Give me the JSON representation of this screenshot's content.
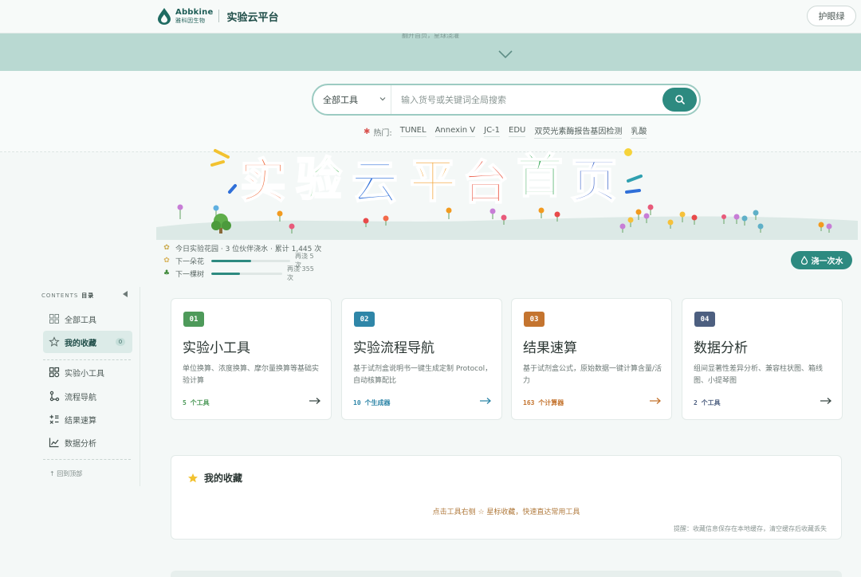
{
  "header": {
    "logo_en": "Abbkine",
    "logo_cn": "雅科因生物",
    "title": "实验云平台",
    "eye_button": "护眼绿"
  },
  "strip": {
    "text": "翻开首页，星球浇灌"
  },
  "search": {
    "scope": "全部工具",
    "placeholder": "输入货号或关键词全局搜索",
    "hot_label": "热门:",
    "hot_tags": [
      "TUNEL",
      "Annexin V",
      "JC-1",
      "EDU",
      "双荧光素酶报告基因检测",
      "乳酸"
    ]
  },
  "banner": {
    "title": "实验云平台首页",
    "colors": [
      "#ef6a3b",
      "#3bb34a",
      "#2f6fd8",
      "#f29a1f",
      "#e8452f",
      "#2fa34f",
      "#3a64c9"
    ]
  },
  "garden": {
    "line1": "今日实验花园 · 3 位伙伴浇水 · 累计 1,445 次",
    "flower_label": "下一朵花",
    "flower_progress": 0.5,
    "flower_remaining": "再浇 5 次",
    "tree_label": "下一棵树",
    "tree_progress": 0.4,
    "tree_remaining": "再浇 355 次",
    "water_button": "浇一次水"
  },
  "sidebar": {
    "contents_en": "CONTENTS",
    "contents_cn": "目录",
    "items": [
      {
        "label": "全部工具"
      },
      {
        "label": "我的收藏",
        "badge": "0"
      },
      {
        "label": "实验小工具"
      },
      {
        "label": "流程导航"
      },
      {
        "label": "结果速算"
      },
      {
        "label": "数据分析"
      }
    ],
    "back_top": "↑ 回到顶部"
  },
  "cards": [
    {
      "num": "01",
      "title": "实验小工具",
      "desc": "单位换算、浓度换算、摩尔量换算等基础实验计算",
      "count": "5 个工具",
      "color": "#4e9a5a"
    },
    {
      "num": "02",
      "title": "实验流程导航",
      "desc": "基于试剂盒说明书一键生成定制 Protocol，自动核算配比",
      "count": "10 个生成器",
      "color": "#2f86a8"
    },
    {
      "num": "03",
      "title": "结果速算",
      "desc": "基于试剂盒公式，原始数据一键计算含量/活力",
      "count": "163 个计算器",
      "color": "#c4742f"
    },
    {
      "num": "04",
      "title": "数据分析",
      "desc": "组间显著性差异分析、兼容柱状图、箱线图、小提琴图",
      "count": "2 个工具",
      "color": "#4d5f80"
    }
  ],
  "favorites": {
    "title": "我的收藏",
    "empty": "点击工具右侧 ☆ 星标收藏，快速直达常用工具",
    "note": "提醒：收藏信息保存在本地缓存，清空缓存后收藏丢失"
  }
}
